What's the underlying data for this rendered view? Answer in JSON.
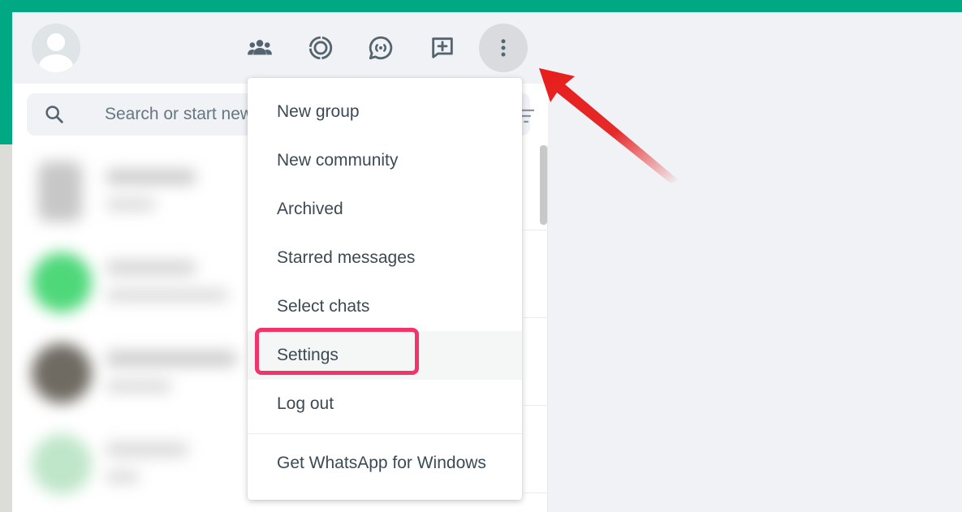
{
  "header": {
    "icons": [
      "communities-icon",
      "status-icon",
      "channels-icon",
      "new-chat-icon",
      "menu-icon"
    ]
  },
  "search": {
    "placeholder": "Search or start new chat"
  },
  "menu": {
    "items": [
      {
        "label": "New group"
      },
      {
        "label": "New community"
      },
      {
        "label": "Archived"
      },
      {
        "label": "Starred messages"
      },
      {
        "label": "Select chats"
      },
      {
        "label": "Settings"
      },
      {
        "label": "Log out"
      },
      {
        "label": "Get WhatsApp for Windows"
      }
    ]
  },
  "colors": {
    "brand_green": "#00a884",
    "highlight_box": "#f2346b",
    "arrow": "#e32222"
  }
}
